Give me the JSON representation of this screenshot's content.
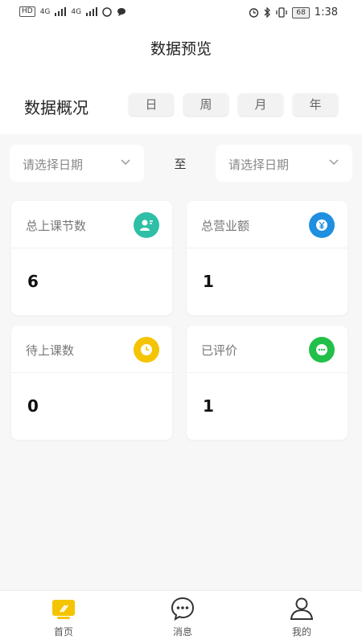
{
  "status_bar": {
    "left_chips": [
      "HD",
      "4G",
      "4G"
    ],
    "battery": "68",
    "time": "1:38"
  },
  "header": {
    "title": "数据预览",
    "section_title": "数据概况",
    "period_tabs": [
      "日",
      "周",
      "月",
      "年"
    ]
  },
  "date_range": {
    "start_placeholder": "请选择日期",
    "separator": "至",
    "end_placeholder": "请选择日期"
  },
  "stats": [
    {
      "label": "总上课节数",
      "value": "6",
      "icon": "user-edit-icon",
      "color": "#2fbfa6"
    },
    {
      "label": "总营业额",
      "value": "1",
      "icon": "yen-icon",
      "color": "#1f8fe0"
    },
    {
      "label": "待上课数",
      "value": "0",
      "icon": "clock-icon",
      "color": "#f5c400"
    },
    {
      "label": "已评价",
      "value": "1",
      "icon": "chat-dots-icon",
      "color": "#22c04a"
    }
  ],
  "tabbar": {
    "items": [
      {
        "label": "首页",
        "icon": "home-icon",
        "color": "#f5c400"
      },
      {
        "label": "消息",
        "icon": "message-icon"
      },
      {
        "label": "我的",
        "icon": "profile-icon"
      }
    ]
  }
}
